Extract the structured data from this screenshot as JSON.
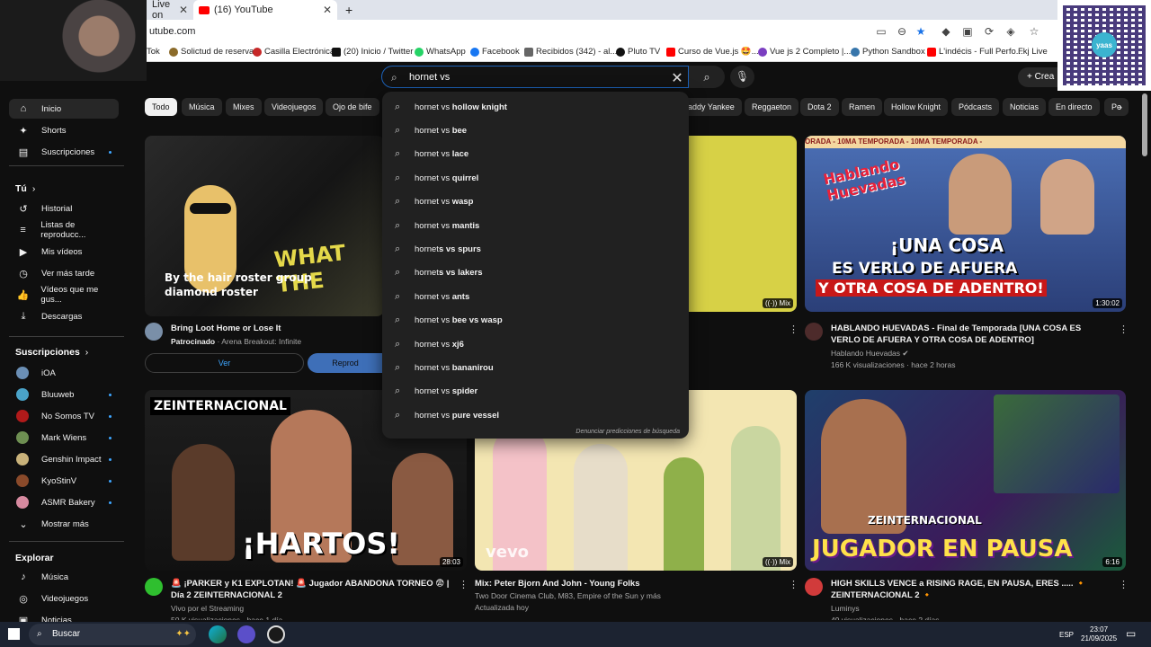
{
  "browser": {
    "tabs": [
      {
        "label": "Live on",
        "active": false
      },
      {
        "label": "(16) YouTube",
        "active": true
      }
    ],
    "new_tab": "+",
    "url": "utube.com",
    "bookmarks": [
      "Tok",
      "Solictud de reserva",
      "Casilla Electrónica",
      "(20) Inicio / Twitter",
      "WhatsApp",
      "Facebook",
      "Recibidos (342) - al...",
      "Pluto TV",
      "Curso de Vue.js 🤩...",
      "Vue js 2 Completo |...",
      "Python Sandbox",
      "L'indécis - Full Perfo...",
      "Fkj Live"
    ]
  },
  "qr_overlay": {
    "center_label": "yaas"
  },
  "search": {
    "query": "hornet vs ",
    "suggestions": [
      {
        "prefix": "hornet vs ",
        "rest": "hollow knight"
      },
      {
        "prefix": "hornet vs ",
        "rest": "bee"
      },
      {
        "prefix": "hornet vs ",
        "rest": "lace"
      },
      {
        "prefix": "hornet vs ",
        "rest": "quirrel"
      },
      {
        "prefix": "hornet vs ",
        "rest": "wasp"
      },
      {
        "prefix": "hornet vs ",
        "rest": "mantis"
      },
      {
        "prefix": "hornet",
        "rest": "s vs spurs"
      },
      {
        "prefix": "hornet",
        "rest": "s vs lakers"
      },
      {
        "prefix": "hornet vs ",
        "rest": "ants"
      },
      {
        "prefix": "hornet vs ",
        "rest": "bee vs wasp"
      },
      {
        "prefix": "hornet vs ",
        "rest": "xj6"
      },
      {
        "prefix": "hornet vs ",
        "rest": "bananirou"
      },
      {
        "prefix": "hornet vs ",
        "rest": "spider"
      },
      {
        "prefix": "hornet vs ",
        "rest": "pure vessel"
      }
    ],
    "report_label": "Denunciar predicciones de búsqueda"
  },
  "create_label": "Crea",
  "sidebar": {
    "main": [
      {
        "label": "Inicio",
        "icon": "home-icon",
        "glyph": "⌂",
        "active": true
      },
      {
        "label": "Shorts",
        "icon": "shorts-icon",
        "glyph": "✦"
      },
      {
        "label": "Suscripciones",
        "icon": "subscriptions-icon",
        "glyph": "▤",
        "dot": true
      }
    ],
    "you_header": "Tú",
    "you": [
      {
        "label": "Historial",
        "icon": "history-icon",
        "glyph": "↺"
      },
      {
        "label": "Listas de reproducc...",
        "icon": "playlists-icon",
        "glyph": "≡"
      },
      {
        "label": "Mis vídeos",
        "icon": "my-videos-icon",
        "glyph": "▶"
      },
      {
        "label": "Ver más tarde",
        "icon": "watch-later-icon",
        "glyph": "◷"
      },
      {
        "label": "Vídeos que me gus...",
        "icon": "liked-icon",
        "glyph": "👍"
      },
      {
        "label": "Descargas",
        "icon": "downloads-icon",
        "glyph": "⤓"
      }
    ],
    "subs_header": "Suscripciones",
    "subs": [
      {
        "label": "iOA",
        "color": "#6b8fb5"
      },
      {
        "label": "Bluuweb",
        "color": "#4aa3c9",
        "dot": true
      },
      {
        "label": "No Somos TV",
        "color": "#b01a1a",
        "dot": true
      },
      {
        "label": "Mark Wiens",
        "color": "#6e8f52",
        "dot": true
      },
      {
        "label": "Genshin Impact",
        "color": "#c9b27a",
        "dot": true
      },
      {
        "label": "KyoStinV",
        "color": "#8a4a2a",
        "dot": true
      },
      {
        "label": "ASMR Bakery",
        "color": "#d78aa0",
        "dot": true
      },
      {
        "label": "Mostrar más",
        "icon": "chevron-down-icon",
        "glyph": "⌄"
      }
    ],
    "explore_header": "Explorar",
    "explore": [
      {
        "label": "Música",
        "icon": "music-icon",
        "glyph": "♪"
      },
      {
        "label": "Videojuegos",
        "icon": "gaming-icon",
        "glyph": "◎"
      },
      {
        "label": "Noticias",
        "icon": "news-icon",
        "glyph": "▣"
      }
    ]
  },
  "chips": [
    "Todo",
    "Música",
    "Mixes",
    "Videojuegos",
    "Ojo de bife",
    "addy Yankee",
    "Reggaeton",
    "Dota 2",
    "Ramen",
    "Hollow Knight",
    "Pódcasts",
    "Noticias",
    "En directo",
    "Pe"
  ],
  "videos": [
    {
      "title": "Bring Loot Home or Lose It",
      "sponsor": "Patrocinado",
      "channel": "Arena Breakout: Infinite",
      "overlay": "By the hair roster group diamond roster",
      "overlay2": "WHAT THE",
      "cta1": "Ver",
      "cta2": "Reprod"
    },
    {
      "badge": "Mix"
    },
    {
      "title": "HABLANDO HUEVADAS - Final de Temporada [UNA COSA ES VERLO DE AFUERA Y OTRA COSA DE ADENTRO]",
      "channel": "Hablando Huevadas ✔",
      "meta": "166 K visualizaciones · hace 2 horas",
      "duration": "1:30:02",
      "banner": "ORADA - 10MA TEMPORADA - 10MA TEMPORADA -",
      "logo": "Hablando Huevadas",
      "line1": "¡UNA COSA",
      "line2": "ES VERLO DE AFUERA",
      "line3": "Y OTRA COSA DE ADENTRO!"
    },
    {
      "title": "🚨 ¡PARKER y K1 EXPLOTAN! 🚨 Jugador ABANDONA TORNEO 😨 | Día 2 ZEINTERNACIONAL 2",
      "channel": "Vivo por el Streaming",
      "meta": "50 K visualizaciones · hace 1 día",
      "duration": "28:03",
      "logo": "ZEINTERNACIONAL",
      "big": "¡HARTOS!"
    },
    {
      "title": "Mix: Peter Bjorn And John - Young Folks",
      "channel": "Two Door Cinema Club, M83, Empire of the Sun y más",
      "meta": "Actualizada hoy",
      "badge": "Mix",
      "watermark": "vevo"
    },
    {
      "title": "HIGH SKILLS VENCE a RISING RAGE, EN PAUSA, ERES ..... 🔸 ZEINTERNACIONAL 2 🔸",
      "channel": "Luminys",
      "meta": "49 visualizaciones · hace 2 días",
      "duration": "6:16",
      "logo": "ZEINTERNACIONAL",
      "big": "JUGADOR EN PAUSA"
    }
  ],
  "taskbar": {
    "search_label": "Buscar",
    "lang": "ESP",
    "time": "23:07",
    "date": "21/09/2025"
  }
}
